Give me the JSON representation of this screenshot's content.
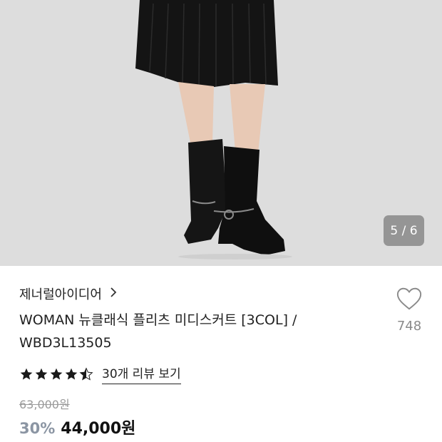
{
  "gallery": {
    "image_label": "product-photo",
    "counter": "5 / 6",
    "current": 5,
    "total": 6
  },
  "product": {
    "brand": "제너럴아이디어",
    "title_line1": "WOMAN 뉴클래식 플리츠 미디스커트 [3COL] /",
    "title_line2": "WBD3L13505",
    "rating": 4.5,
    "review_link": "30개 리뷰 보기",
    "original_price": "63,000원",
    "discount": "30%",
    "price": "44,000원"
  },
  "wishlist": {
    "count": "748",
    "icon": "heart-icon"
  },
  "colors": {
    "discount": "#8b95a3",
    "background_photo": "#dcdcdc"
  }
}
